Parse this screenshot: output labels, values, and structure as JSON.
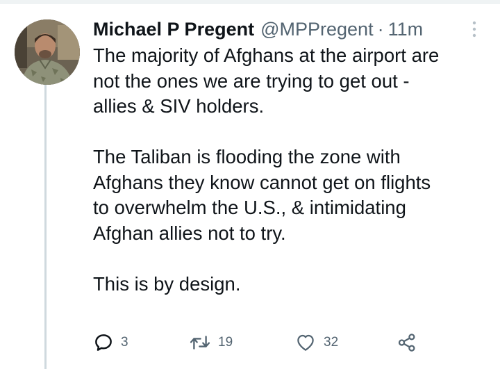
{
  "tweet": {
    "author": {
      "display_name": "Michael P Pregent",
      "handle": "@MPPregent",
      "separator": "·",
      "time": "11m",
      "avatar": "profile-photo-man-in-camouflage"
    },
    "paragraphs": [
      [
        "The majority of Afghans at the airport are",
        "not the ones we are trying to get out -",
        "allies & SIV holders."
      ],
      [
        "The Taliban is flooding the zone with",
        "Afghans they know cannot get on flights",
        "to overwhelm the U.S., & intimidating",
        "Afghan allies not to try."
      ],
      [
        "This is by design."
      ]
    ],
    "actions": {
      "reply": {
        "icon": "reply-icon",
        "count": "3"
      },
      "retweet": {
        "icon": "retweet-icon",
        "count": "19"
      },
      "like": {
        "icon": "heart-icon",
        "count": "32"
      },
      "share": {
        "icon": "share-icon"
      }
    },
    "more_icon": "more-options-icon"
  },
  "colors": {
    "text_primary": "#0f1419",
    "text_secondary": "#536471",
    "thread_line": "#cfd9de",
    "background": "#ffffff"
  }
}
